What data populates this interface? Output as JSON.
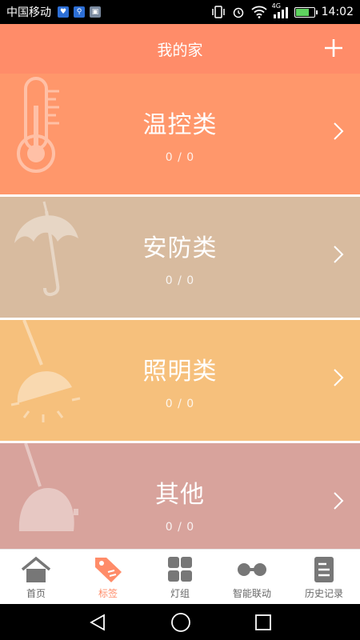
{
  "status_bar": {
    "carrier": "中国移动",
    "network": "4G",
    "time": "14:02"
  },
  "header": {
    "title": "我的家",
    "add_icon": "plus-icon"
  },
  "categories": [
    {
      "title": "温控类",
      "count": "0 / 0",
      "color": "#ff976b",
      "icon": "thermometer-icon"
    },
    {
      "title": "安防类",
      "count": "0 / 0",
      "color": "#d8bb9f",
      "icon": "umbrella-icon"
    },
    {
      "title": "照明类",
      "count": "0 / 0",
      "color": "#f6c07c",
      "icon": "lamp-icon"
    },
    {
      "title": "其他",
      "count": "0 / 0",
      "color": "#d8a39c",
      "icon": "plug-icon"
    }
  ],
  "tabs": [
    {
      "label": "首页",
      "icon": "home-icon",
      "active": false
    },
    {
      "label": "标签",
      "icon": "tag-icon",
      "active": true
    },
    {
      "label": "灯组",
      "icon": "grid-icon",
      "active": false
    },
    {
      "label": "智能联动",
      "icon": "link-icon",
      "active": false
    },
    {
      "label": "历史记录",
      "icon": "document-icon",
      "active": false
    }
  ],
  "colors": {
    "accent": "#ff8c69",
    "tab_inactive": "#666666"
  }
}
